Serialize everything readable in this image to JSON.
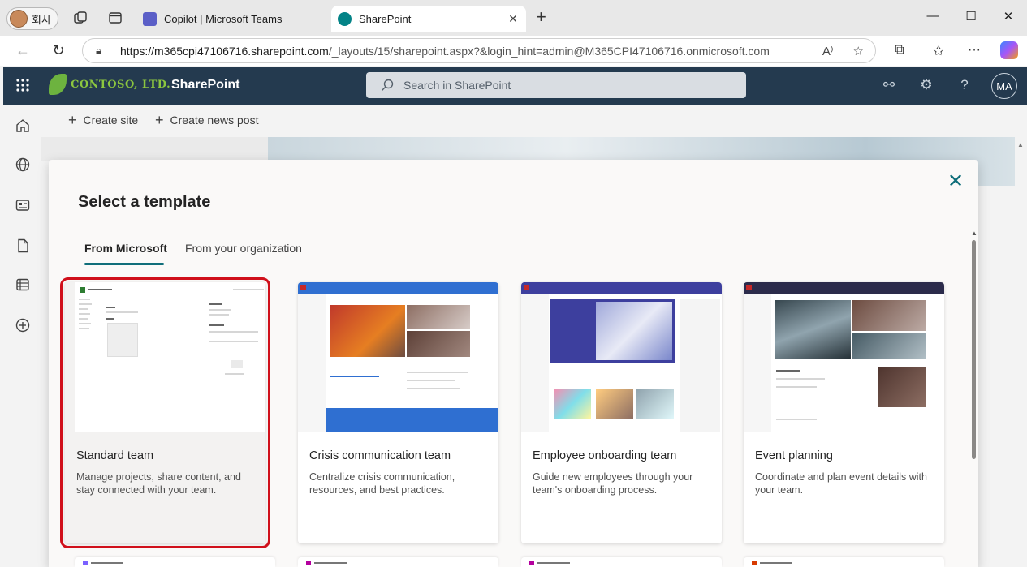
{
  "browser": {
    "profile_label": "회사",
    "tabs": [
      {
        "label": "Copilot | Microsoft Teams",
        "icon": "teams-icon",
        "active": false
      },
      {
        "label": "SharePoint",
        "icon": "sharepoint-icon",
        "active": true
      }
    ],
    "url_host": "https://m365cpi47106716.sharepoint.com",
    "url_path": "/_layouts/15/sharepoint.aspx?&login_hint=admin@M365CPI47106716.onmicrosoft.com"
  },
  "suitebar": {
    "brand": "CONTOSO, LTD.",
    "app_name": "SharePoint",
    "search_placeholder": "Search in SharePoint",
    "avatar_initials": "MA"
  },
  "commands": {
    "create_site": "Create site",
    "create_news_post": "Create news post"
  },
  "dialog": {
    "title": "Select a template",
    "tabs": [
      {
        "label": "From Microsoft",
        "selected": true
      },
      {
        "label": "From your organization",
        "selected": false
      }
    ],
    "templates": [
      {
        "title": "Standard team",
        "description": "Manage projects, share content, and stay connected with your team.",
        "selected": true
      },
      {
        "title": "Crisis communication team",
        "description": "Centralize crisis communication, resources, and best practices.",
        "selected": false
      },
      {
        "title": "Employee onboarding team",
        "description": "Guide new employees through your team's onboarding process.",
        "selected": false
      },
      {
        "title": "Event planning",
        "description": "Coordinate and plan event details with your team.",
        "selected": false
      }
    ]
  },
  "colors": {
    "suitebar_bg": "#243a4f",
    "accent_teal": "#0f6e7a",
    "selection_red": "#d0101b",
    "brand_green": "#8cc63f"
  }
}
